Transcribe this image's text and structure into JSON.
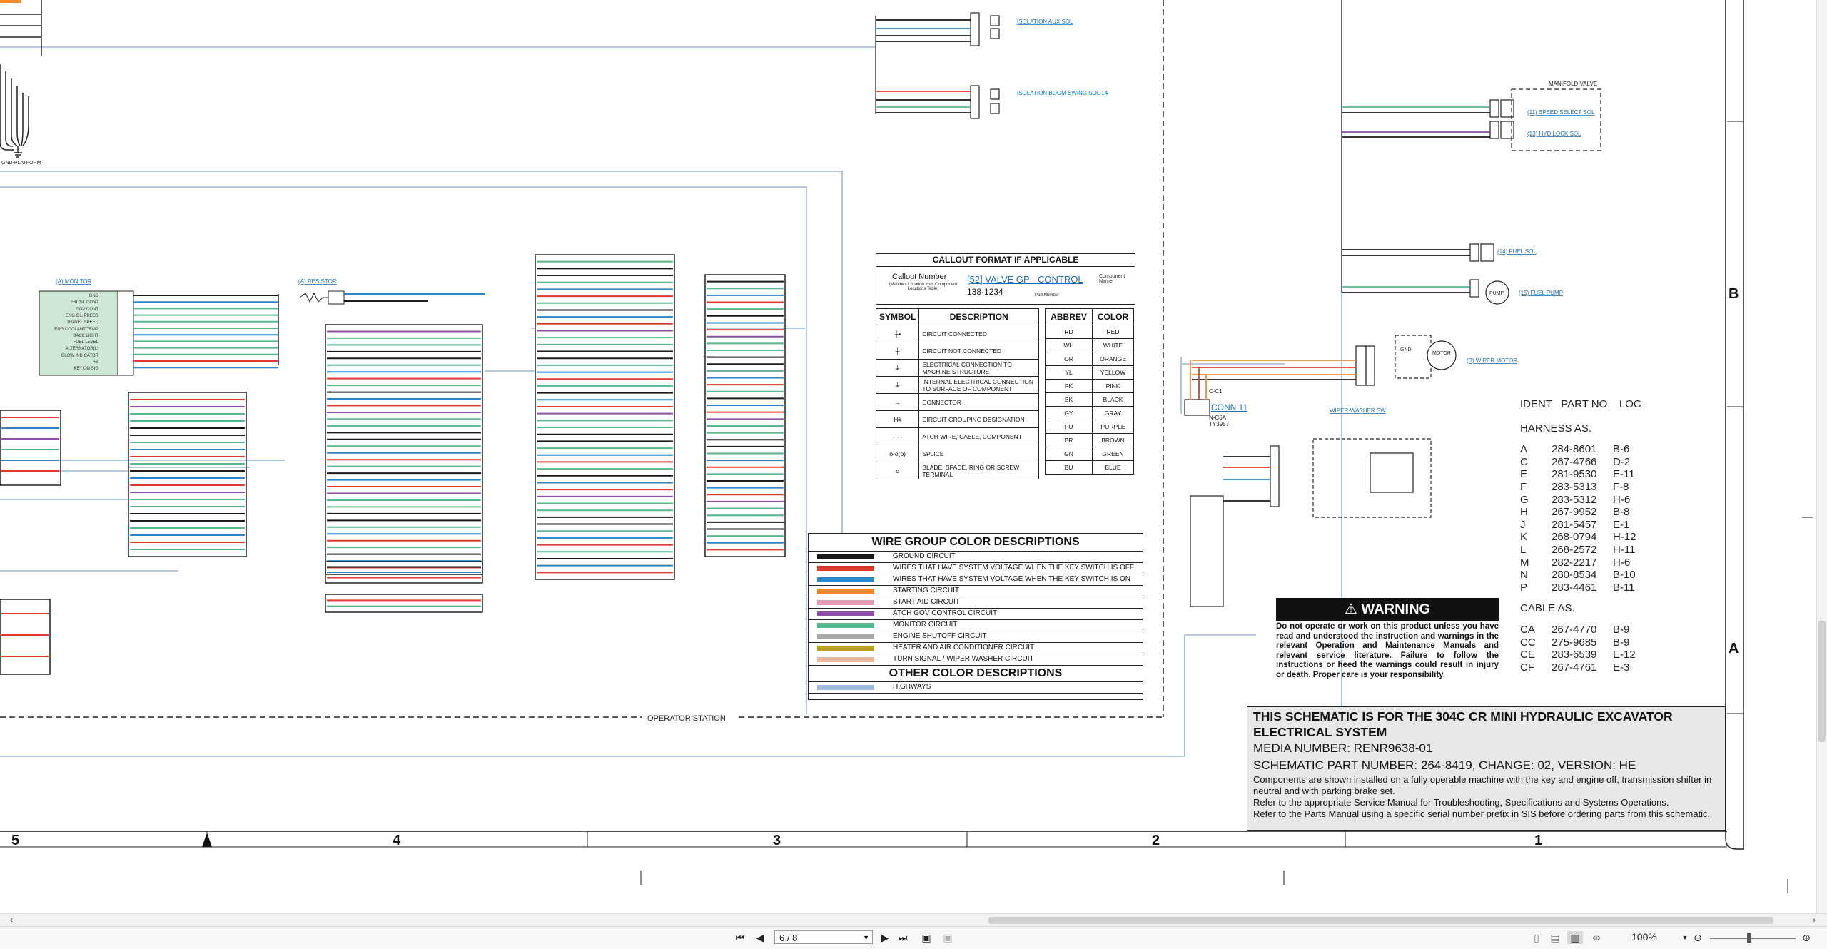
{
  "connector_tags": {
    "gnd_platform": "GND-PLATFORM",
    "operator_station": "OPERATOR STATION",
    "conn11": "CONN 11",
    "conn11_id": "C-C1",
    "conn11_sub": "TY3957",
    "conn11_part": "N-C6A"
  },
  "component_links": {
    "isolation_aux_sol": "ISOLATION AUX SOL",
    "isolation_boom_swing": "ISOLATION BOOM SWING SOL 14",
    "monitor": "(A) MONITOR",
    "resistor": "(A) RESISTOR",
    "manifold_valve": "MANIFOLD VALVE",
    "speed_select_sol": "(11) SPEED SELECT SOL",
    "hyd_lock_sol": "(13) HYD LOCK SOL",
    "fuel_sol": "(14) FUEL SOL",
    "fuel_pump": "(15) FUEL PUMP",
    "wiper_motor": "(B) WIPER MOTOR",
    "wiper_washer_sw": "WIPER-WASHER SW",
    "pump_label": "PUMP",
    "motor_label": "MOTOR",
    "gnd_label": "GND"
  },
  "monitor_signals": [
    "GND",
    "FRONT CONT",
    "GDV CONT",
    "ENG OIL PRESS",
    "TRAVEL SPEED",
    "ENG COOLANT TEMP",
    "BACK LIGHT",
    "FUEL LEVEL",
    "ALTERNATOR(L)",
    "GLOW INDICATOR",
    "+B",
    "KEY ON SIG"
  ],
  "callout": {
    "header": "CALLOUT FORMAT IF APPLICABLE",
    "callout_number": "Callout Number",
    "callout_note": "(Matches Location from Component Locations Table)",
    "example_name": "[52] VALVE GP - CONTROL",
    "component_name": "Component Name",
    "part_example": "138-1234",
    "part_number": "Part Number"
  },
  "symbol_table": {
    "headers": [
      "SYMBOL",
      "DESCRIPTION"
    ],
    "rows": [
      {
        "sym": "┼•",
        "desc": "CIRCUIT CONNECTED"
      },
      {
        "sym": "┼",
        "desc": "CIRCUIT NOT CONNECTED"
      },
      {
        "sym": "⏚",
        "desc": "ELECTRICAL CONNECTION TO MACHINE STRUCTURE"
      },
      {
        "sym": "⏚",
        "desc": "INTERNAL ELECTRICAL CONNECTION TO SURFACE OF COMPONENT"
      },
      {
        "sym": "→",
        "desc": "CONNECTOR"
      },
      {
        "sym": "H#",
        "desc": "CIRCUIT GROUPING DESIGNATION"
      },
      {
        "sym": "- - -",
        "desc": "ATCH WIRE, CABLE, COMPONENT"
      },
      {
        "sym": "o-o(o)",
        "desc": "SPLICE"
      },
      {
        "sym": "o",
        "desc": "BLADE, SPADE, RING OR SCREW TERMINAL"
      }
    ]
  },
  "abbr_table": {
    "headers": [
      "ABBREV",
      "COLOR"
    ],
    "rows": [
      [
        "RD",
        "RED"
      ],
      [
        "WH",
        "WHITE"
      ],
      [
        "OR",
        "ORANGE"
      ],
      [
        "YL",
        "YELLOW"
      ],
      [
        "PK",
        "PINK"
      ],
      [
        "BK",
        "BLACK"
      ],
      [
        "GY",
        "GRAY"
      ],
      [
        "PU",
        "PURPLE"
      ],
      [
        "BR",
        "BROWN"
      ],
      [
        "GN",
        "GREEN"
      ],
      [
        "BU",
        "BLUE"
      ]
    ]
  },
  "wire_groups": {
    "title": "WIRE GROUP COLOR DESCRIPTIONS",
    "rows": [
      {
        "color": "#1a1a1a",
        "label": "GROUND CIRCUIT"
      },
      {
        "color": "#e03a2f",
        "label": "WIRES THAT HAVE SYSTEM VOLTAGE WHEN THE KEY SWITCH IS OFF"
      },
      {
        "color": "#2a86c8",
        "label": "WIRES THAT HAVE SYSTEM VOLTAGE WHEN THE KEY SWITCH IS ON"
      },
      {
        "color": "#f08a2c",
        "label": "STARTING CIRCUIT"
      },
      {
        "color": "#e49ab0",
        "label": "START AID CIRCUIT"
      },
      {
        "color": "#8e4fa6",
        "label": "ATCH GOV CONTROL CIRCUIT"
      },
      {
        "color": "#55b88c",
        "label": "MONITOR CIRCUIT"
      },
      {
        "color": "#a9a9a9",
        "label": "ENGINE SHUTOFF CIRCUIT"
      },
      {
        "color": "#b8a320",
        "label": "HEATER AND AIR CONDITIONER CIRCUIT"
      },
      {
        "color": "#e9b79c",
        "label": "TURN SIGNAL / WIPER WASHER CIRCUIT"
      }
    ],
    "other_title": "OTHER COLOR DESCRIPTIONS",
    "other_rows": [
      {
        "color": "#9cb9dc",
        "label": "HIGHWAYS"
      }
    ]
  },
  "warning": {
    "title": "WARNING",
    "text": "Do not operate or work on this product unless you have read and understood the instruction and warnings in the relevant Operation and Maintenance Manuals and relevant service literature. Failure to follow the instructions or heed the warnings could result in injury or death. Proper care is your responsibility."
  },
  "ident": {
    "header": "IDENT   PART NO.   LOC",
    "harness_title": "HARNESS AS.",
    "harness": [
      [
        "A",
        "284-8601",
        "B-6"
      ],
      [
        "C",
        "267-4766",
        "D-2"
      ],
      [
        "E",
        "281-9530",
        "E-11"
      ],
      [
        "F",
        "283-5313",
        "F-8"
      ],
      [
        "G",
        "283-5312",
        "H-6"
      ],
      [
        "H",
        "267-9952",
        "B-8"
      ],
      [
        "J",
        "281-5457",
        "E-1"
      ],
      [
        "K",
        "268-0794",
        "H-12"
      ],
      [
        "L",
        "268-2572",
        "H-11"
      ],
      [
        "M",
        "282-2217",
        "H-6"
      ],
      [
        "N",
        "280-8534",
        "B-10"
      ],
      [
        "P",
        "283-4461",
        "B-11"
      ]
    ],
    "cable_title": "CABLE AS.",
    "cable": [
      [
        "CA",
        "267-4770",
        "B-9"
      ],
      [
        "CC",
        "275-9685",
        "B-9"
      ],
      [
        "CE",
        "283-6539",
        "E-12"
      ],
      [
        "CF",
        "267-4761",
        "E-3"
      ]
    ]
  },
  "info": {
    "title": "THIS SCHEMATIC IS FOR THE 304C CR MINI HYDRAULIC EXCAVATOR ELECTRICAL SYSTEM",
    "media": "MEDIA NUMBER: RENR9638-01",
    "part": "SCHEMATIC PART NUMBER: 264-8419, CHANGE: 02, VERSION: HE",
    "note1": "Components are shown installed on a fully operable machine with the key and engine off, transmission shifter in neutral and with parking brake set.",
    "note2": "Refer to the appropriate Service Manual for Troubleshooting, Specifications and Systems Operations.",
    "note3": "Refer to the Parts Manual using a specific serial number prefix in SIS before ordering parts from this schematic."
  },
  "grid": {
    "columns": [
      "5",
      "4",
      "3",
      "2",
      "1"
    ],
    "rows": [
      "B",
      "A"
    ]
  },
  "toolbar": {
    "page": "6 / 8",
    "zoom": "100%"
  },
  "colors": {
    "ground": "#1a1a1a",
    "key_off": "#e03a2f",
    "key_on": "#2a86c8",
    "starting": "#f08a2c",
    "monitor": "#55b88c",
    "atch": "#8e4fa6",
    "highway": "#9cb9dc"
  }
}
